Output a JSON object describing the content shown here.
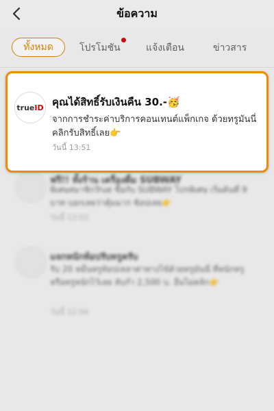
{
  "header": {
    "title": "ข้อความ"
  },
  "tabs": [
    {
      "label": "ทั้งหมด"
    },
    {
      "label": "โปรโมชัน"
    },
    {
      "label": "แจ้งเตือน"
    },
    {
      "label": "ข่าวสาร"
    }
  ],
  "messages": [
    {
      "logo": {
        "part1": "true",
        "part2": "ID"
      },
      "title": "คุณได้สิทธิ์รับเงินคืน 30.-🥳",
      "body": "จากการชำระค่าบริการคอนเทนต์แพ็กเกจ ด้วยทรูมันนี่ คลิกรับสิทธิ์เลย👉",
      "time": "วันนี้ 13:51"
    },
    {
      "title": "ฟรี!! ทั้งร้าน เครื่องดื่ม SUBWAY",
      "body": "พิเศษสมาชิกTrue ซื้อกับ SUBWAY โปรพิเศษ เริ่มต้นที่ 9 บาท บอกเลยว่าคุ้มมาก ช้อปเลย👉",
      "time": "วันนี้ 13:03"
    },
    {
      "title": "แจกหนักท้อปรับทรูครับ",
      "body": "รับ 20 หมื่นทรูท้อปเหลาค่าทางไข้ด้วยทรูมันนี่ ที่หนักทรูหรือทรูหนักไว้เลย ลับกำ 2,500 บ. อื่นไม่คลิก👉",
      "time": "วันนี้ 12:04"
    }
  ]
}
